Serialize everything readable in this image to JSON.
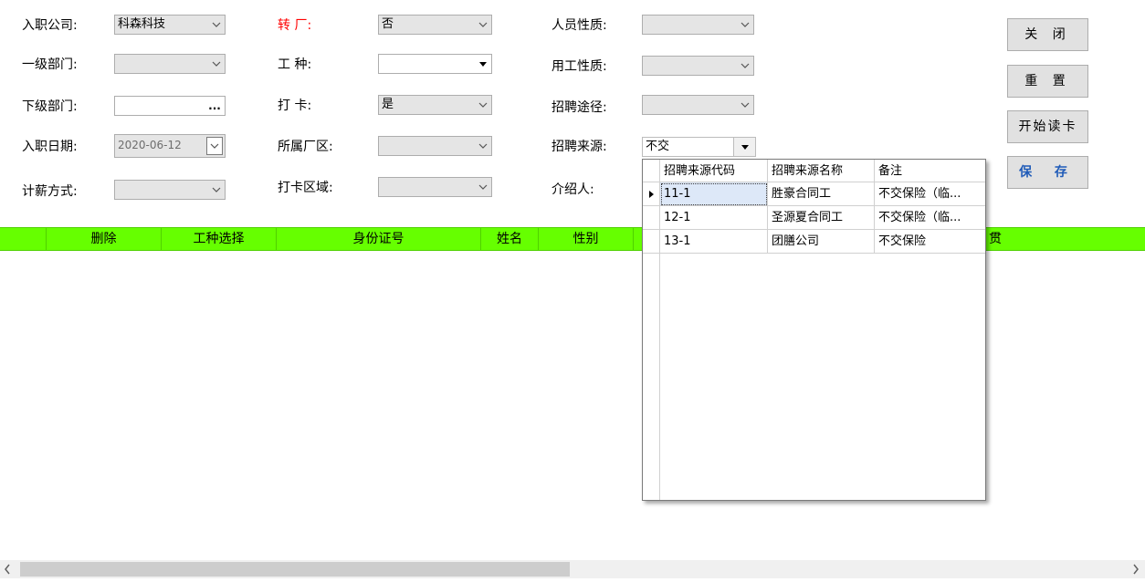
{
  "form": {
    "company_label": "入职公司:",
    "company_value": "科森科技",
    "dept1_label": "一级部门:",
    "dept1_value": "",
    "subdept_label": "下级部门:",
    "subdept_button": "...",
    "hire_date_label": "入职日期:",
    "hire_date_value": "2020-06-12",
    "salary_label": "计薪方式:",
    "salary_value": "",
    "transfer_label": "转 厂:",
    "transfer_value": "否",
    "worktype_label": "工 种:",
    "worktype_value": "",
    "punch_label": "打 卡:",
    "punch_value": "是",
    "factory_label": "所属厂区:",
    "factory_value": "",
    "punch_area_label": "打卡区域:",
    "punch_area_value": "",
    "person_nature_label": "人员性质:",
    "person_nature_value": "",
    "employ_nature_label": "用工性质:",
    "employ_nature_value": "",
    "recruit_channel_label": "招聘途径:",
    "recruit_channel_value": "",
    "recruit_source_label": "招聘来源:",
    "recruit_source_value": "不交",
    "referrer_label": "介绍人:"
  },
  "buttons": {
    "close": "关 闭",
    "reset": "重 置",
    "read_card": "开始读卡",
    "save": "保 存"
  },
  "grid": {
    "columns": [
      "删除",
      "工种选择",
      "身份证号",
      "姓名",
      "性别",
      "贯"
    ]
  },
  "dropdown": {
    "columns": [
      "招聘来源代码",
      "招聘来源名称",
      "备注"
    ],
    "rows": [
      {
        "code": "11-1",
        "name": "胜豪合同工",
        "note": "不交保险（临..."
      },
      {
        "code": "12-1",
        "name": "圣源夏合同工",
        "note": "不交保险（临..."
      },
      {
        "code": "13-1",
        "name": "团膳公司",
        "note": "不交保险"
      }
    ]
  },
  "icons": {
    "combo_arrow": "chevron-down-icon",
    "row_indicator": "triangle-right-icon",
    "scroll_left": "chevron-left-icon",
    "scroll_right": "chevron-right-icon"
  }
}
